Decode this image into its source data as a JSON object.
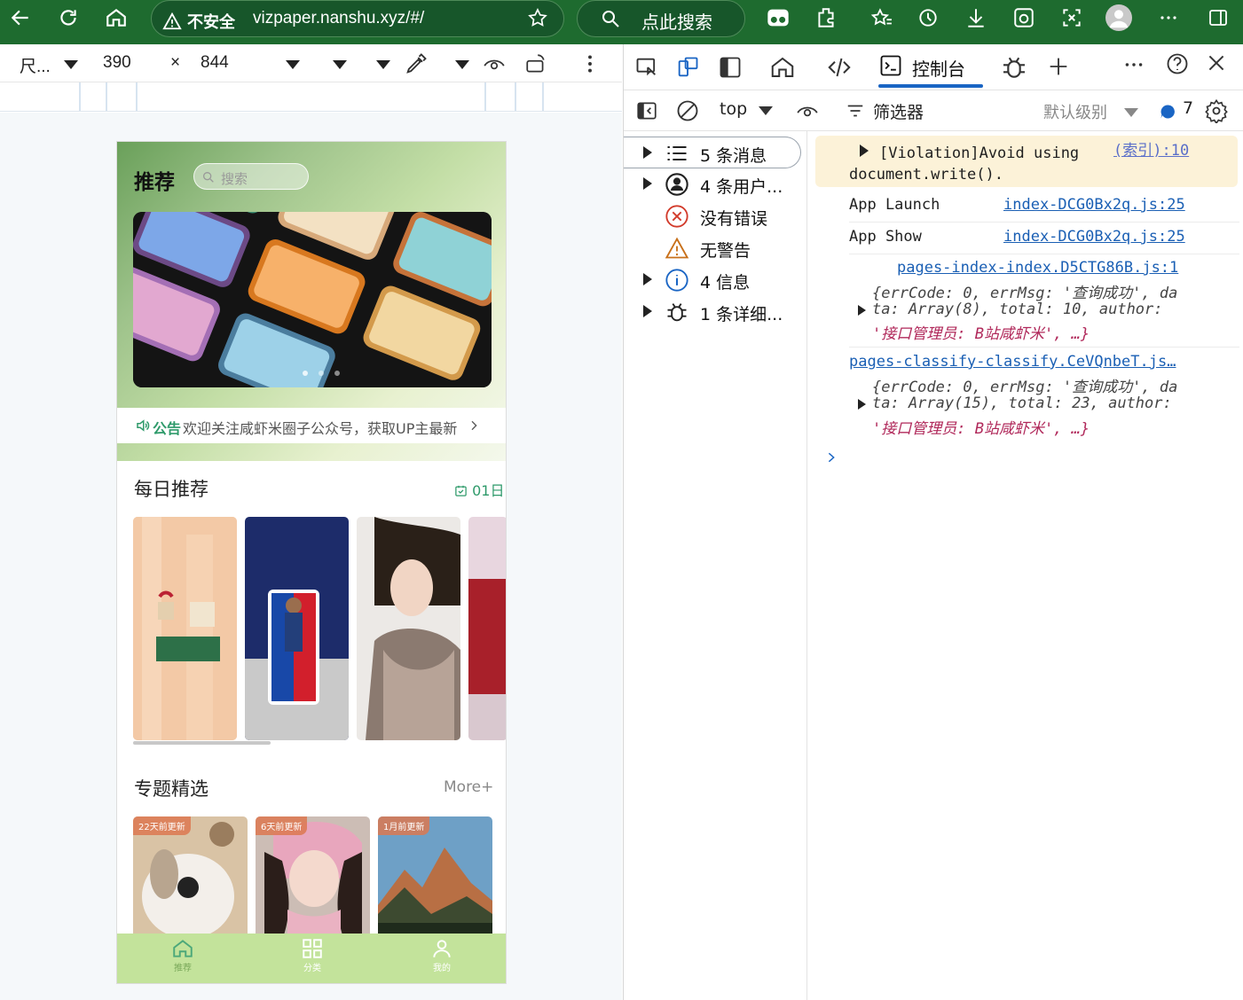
{
  "browser": {
    "security_label": "不安全",
    "url": "vizpaper.nanshu.xyz/#/",
    "search_label": "点此搜索"
  },
  "device_toolbar": {
    "device": "尺...",
    "width": "390",
    "times": "×",
    "height": "844"
  },
  "phone": {
    "title": "推荐",
    "search_placeholder": "搜索",
    "notice_label": "公告",
    "notice_text": "欢迎关注咸虾米圈子公众号，获取UP主最新动态",
    "daily_title": "每日推荐",
    "daily_date": "01日",
    "topics_title": "专题精选",
    "more_label": "More+",
    "topics": [
      {
        "badge": "22天前更新"
      },
      {
        "badge": "6天前更新"
      },
      {
        "badge": "1月前更新"
      }
    ],
    "tabs": [
      {
        "label": "推荐"
      },
      {
        "label": "分类"
      },
      {
        "label": "我的"
      }
    ],
    "colors": {
      "accent": "#2e9a6a",
      "tabbar": "#c3e39b"
    }
  },
  "devtools": {
    "console_tab": "控制台",
    "context": "top",
    "filter": "筛选器",
    "level": "默认级别",
    "issue_count": "7",
    "sidebar": [
      {
        "label": "5 条消息",
        "icon": "list-icon"
      },
      {
        "label": "4 条用户...",
        "icon": "user-icon"
      },
      {
        "label": "没有错误",
        "icon": "error-icon"
      },
      {
        "label": "无警告",
        "icon": "warning-icon"
      },
      {
        "label": "4 信息",
        "icon": "info-icon"
      },
      {
        "label": "1 条详细...",
        "icon": "bug-icon"
      }
    ],
    "console": {
      "violation_text1": "[Violation]Avoid using",
      "violation_text2": "document.write().",
      "violation_src": "(索引):10",
      "launch": "App Launch",
      "launch_src": "index-DCG0Bx2q.js:25",
      "show": "App Show",
      "show_src": "index-DCG0Bx2q.js:25",
      "log1_src": "pages-index-index.D5CTG86B.js:1",
      "log1_l1": "{errCode: 0, errMsg: '查询成功', da",
      "log1_l2": "ta: Array(8), total: 10, author:",
      "log1_l3": "'接口管理员: B站咸虾米', …}",
      "log2_src": "pages-classify-classify.CeVQnbeT.js…",
      "log2_l1": "{errCode: 0, errMsg: '查询成功', da",
      "log2_l2": "ta: Array(15), total: 23, author:",
      "log2_l3": "'接口管理员: B站咸虾米', …}"
    }
  }
}
